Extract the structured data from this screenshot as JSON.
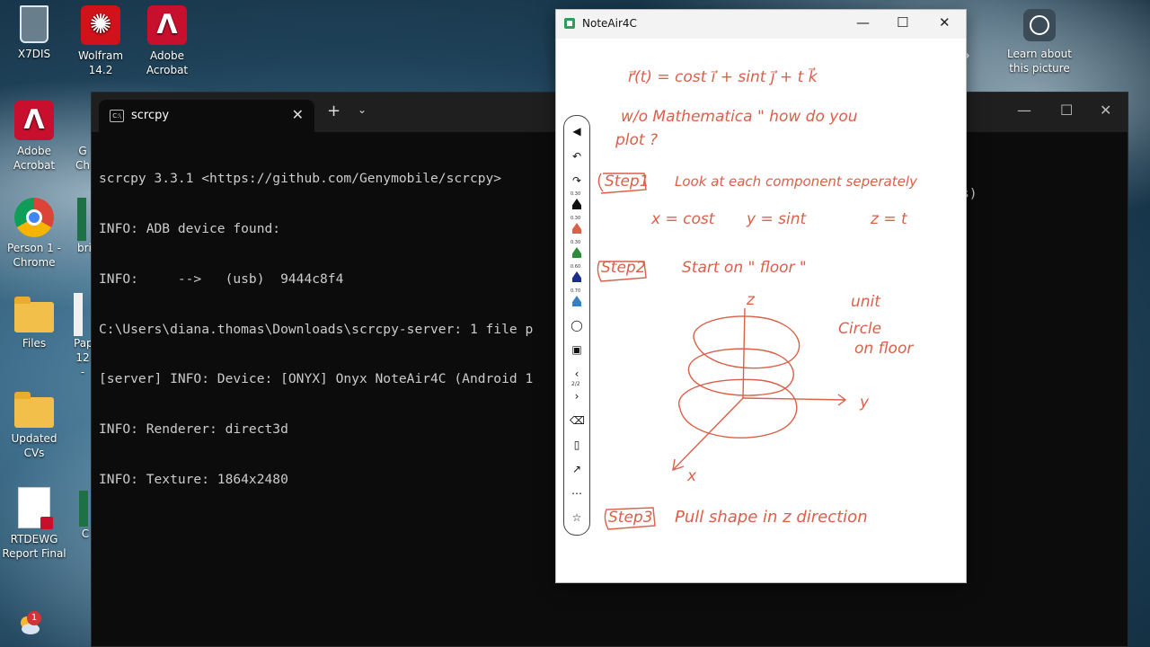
{
  "desktop": {
    "icons": [
      {
        "label": "X7DIS"
      },
      {
        "label": "Wolfram 14.2"
      },
      {
        "label": "Adobe Acrobat"
      },
      {
        "label": "Adobe Acrobat"
      },
      {
        "label": "Person 1 - Chrome"
      },
      {
        "label": "Files"
      },
      {
        "label": "Updated CVs"
      },
      {
        "label": "RTDEWG Report Final"
      }
    ],
    "partial_labels": [
      "G",
      "Ch",
      "britt",
      "Pap",
      "12 -",
      "C"
    ],
    "learn_label": "Learn about this picture",
    "notification_count": "1"
  },
  "terminal": {
    "tab_label": "scrcpy",
    "tab_icon": "C:\\",
    "tab_close": "✕",
    "new_tab": "+",
    "dropdown": "⌄",
    "lines": [
      "scrcpy 3.3.1 <https://github.com/Genymobile/scrcpy>",
      "INFO: ADB device found:",
      "INFO:     -->   (usb)  9444c8f4",
      "C:\\Users\\diana.thomas\\Downloads\\scrcpy-server: 1 file p",
      "[server] INFO: Device: [ONYX] Onyx NoteAir4C (Android 1",
      "INFO: Renderer: direct3d",
      "INFO: Texture: 1864x2480"
    ],
    "overflow_text": "s)"
  },
  "note": {
    "title": "NoteAir4C",
    "pen_sizes": [
      "0.30",
      "0.30",
      "0.30",
      "0.60",
      "0.70"
    ],
    "page_indicator": "2/2",
    "ink_color": "#d9604a",
    "handwriting": {
      "line1": "r⃗(t) = cost i⃗ + sint j⃗ + t k⃗",
      "line2a": "w/o Mathematica \" how do you",
      "line2b": "plot ?",
      "step1_tag": "Step1",
      "step1_text": "Look at each component seperately",
      "eq_x": "x = cost",
      "eq_y": "y = sint",
      "eq_z": "z = t",
      "step2_tag": "Step2",
      "step2_text": "Start on \" floor \"",
      "z_label": "z",
      "y_label": "y",
      "x_label": "x",
      "unit1": "unit",
      "unit2": "Circle",
      "unit3": "on floor",
      "step3_tag": "Step3",
      "step3_text": "Pull shape in z direction"
    }
  }
}
